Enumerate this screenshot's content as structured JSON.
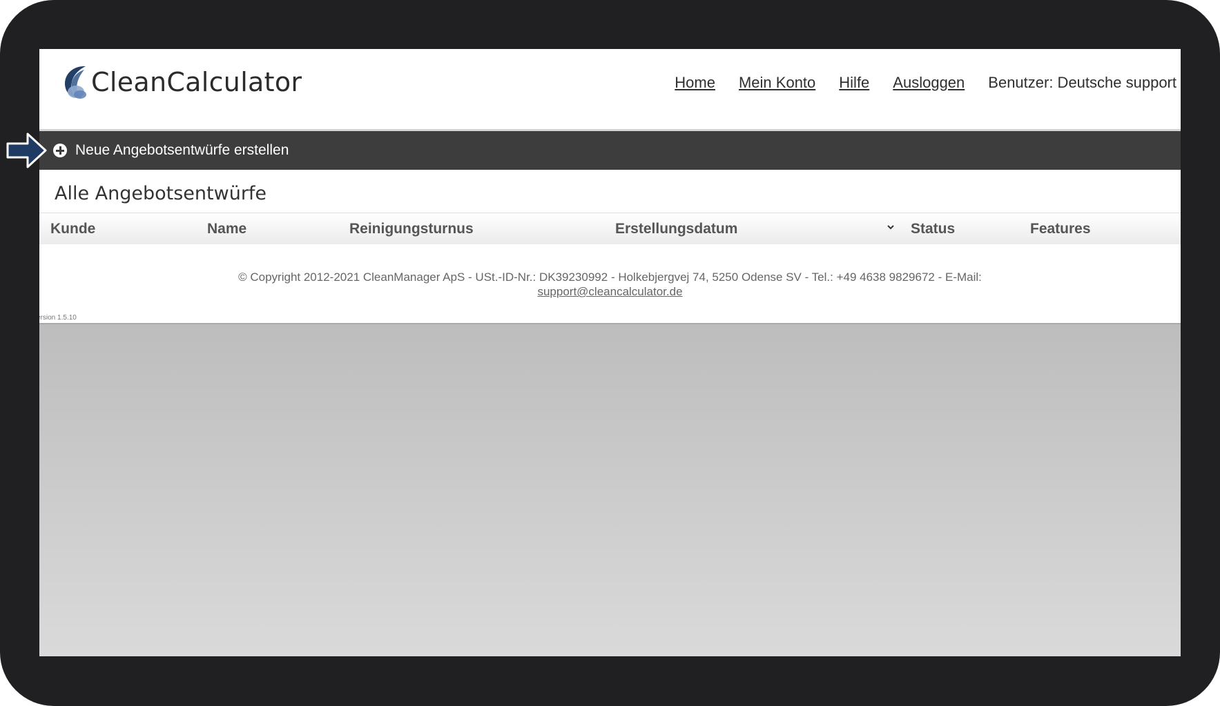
{
  "app": {
    "name": "CleanCalculator"
  },
  "nav": {
    "home": "Home",
    "account": "Mein Konto",
    "help": "Hilfe",
    "logout": "Ausloggen",
    "user": "Benutzer: Deutsche support"
  },
  "toolbar": {
    "new_label": "Neue Angebotsentwürfe erstellen"
  },
  "section": {
    "title": "Alle Angebotsentwürfe"
  },
  "table": {
    "columns": [
      "Kunde",
      "Name",
      "Reinigungsturnus",
      "Erstellungsdatum",
      "Status",
      "Features"
    ],
    "rows": []
  },
  "footer": {
    "copyright": "© Copyright 2012-2021 CleanManager ApS - USt.-ID-Nr.: DK39230992 - Holkebjergvej 74, 5250 Odense SV - Tel.: +49 4638 9829672 - E-Mail:",
    "email": "support@cleancalculator.de",
    "version": "ersion 1.5.10"
  },
  "colors": {
    "frame": "#201f21",
    "toolbar": "#3d3d3d",
    "arrow_fill": "#1f3b63",
    "logo_primary": "#2f4c78"
  },
  "icons": [
    "logo-icon",
    "plus-circle-icon",
    "sort-chevron-icon",
    "pointer-arrow-icon"
  ]
}
